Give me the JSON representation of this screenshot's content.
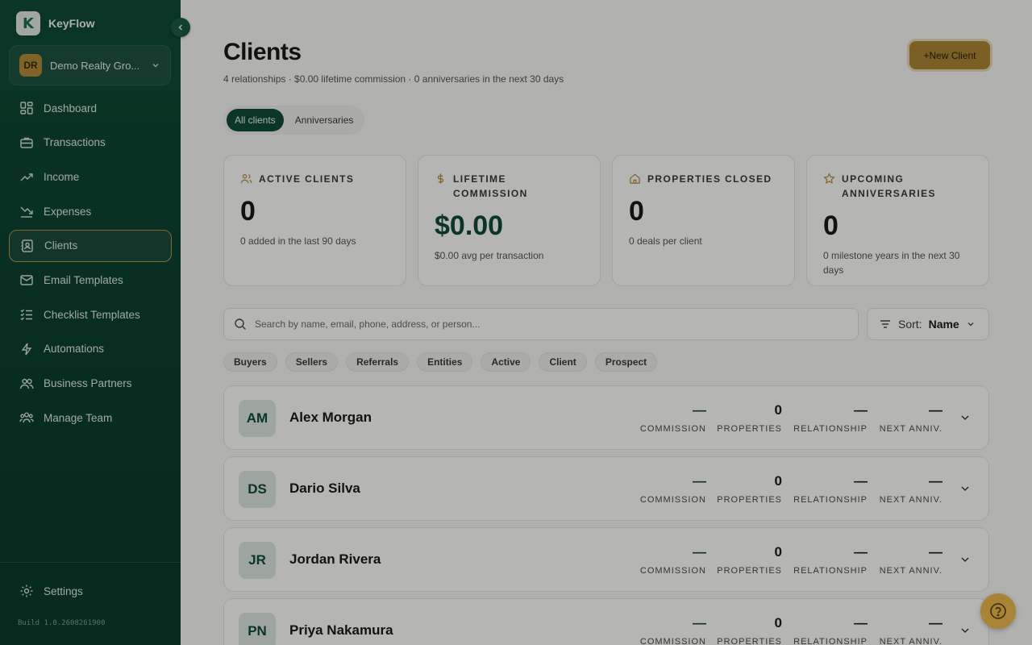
{
  "sidebar": {
    "brand": "KeyFlow",
    "brand_logo_letter": "K",
    "org": {
      "initials": "DR",
      "name": "Demo Realty Gro..."
    },
    "nav": [
      {
        "label": "Dashboard",
        "icon": "dashboard-icon"
      },
      {
        "label": "Transactions",
        "icon": "briefcase-icon"
      },
      {
        "label": "Income",
        "icon": "trending-up-icon"
      },
      {
        "label": "Expenses",
        "icon": "trending-down-icon"
      },
      {
        "label": "Clients",
        "icon": "contacts-icon",
        "active": true
      },
      {
        "label": "Email Templates",
        "icon": "mail-icon"
      },
      {
        "label": "Checklist Templates",
        "icon": "checklist-icon"
      },
      {
        "label": "Automations",
        "icon": "lightning-icon"
      },
      {
        "label": "Business Partners",
        "icon": "partners-icon"
      },
      {
        "label": "Manage Team",
        "icon": "team-icon"
      }
    ],
    "settings": "Settings",
    "build": "Build 1.0.2608261900"
  },
  "header": {
    "title": "Clients",
    "subtitle": "4 relationships · $0.00 lifetime commission · 0 anniversaries in the next 30 days",
    "new_client": "+New Client"
  },
  "tabs": [
    "All clients",
    "Anniversaries"
  ],
  "stats": [
    {
      "label": "ACTIVE CLIENTS",
      "value": "0",
      "note": "0 added in the last 90 days",
      "icon": "users-icon"
    },
    {
      "label": "LIFETIME COMMISSION",
      "value": "$0.00",
      "note": "$0.00 avg per transaction",
      "icon": "dollar-icon"
    },
    {
      "label": "PROPERTIES CLOSED",
      "value": "0",
      "note": "0 deals per client",
      "icon": "home-icon"
    },
    {
      "label": "UPCOMING ANNIVERSARIES",
      "value": "0",
      "note": "0 milestone years in the next 30 days",
      "icon": "star-icon"
    }
  ],
  "search": {
    "placeholder": "Search by name, email, phone, address, or person..."
  },
  "sort": {
    "label": "Sort:",
    "value": "Name"
  },
  "filters": [
    "Buyers",
    "Sellers",
    "Referrals",
    "Entities",
    "Active",
    "Client",
    "Prospect"
  ],
  "metric_labels": {
    "commission": "COMMISSION",
    "properties": "PROPERTIES",
    "relationship": "RELATIONSHIP",
    "next_anniv": "NEXT ANNIV."
  },
  "clients": [
    {
      "initials": "AM",
      "name": "Alex Morgan",
      "commission": "—",
      "properties": "0",
      "relationship": "—",
      "next_anniv": "—"
    },
    {
      "initials": "DS",
      "name": "Dario Silva",
      "commission": "—",
      "properties": "0",
      "relationship": "—",
      "next_anniv": "—"
    },
    {
      "initials": "JR",
      "name": "Jordan Rivera",
      "commission": "—",
      "properties": "0",
      "relationship": "—",
      "next_anniv": "—"
    },
    {
      "initials": "PN",
      "name": "Priya Nakamura",
      "commission": "—",
      "properties": "0",
      "relationship": "—",
      "next_anniv": "—"
    }
  ],
  "colors": {
    "sidebar": "#0f4a36",
    "accent_gold": "#a98437",
    "brand_green": "#0f4a36"
  }
}
